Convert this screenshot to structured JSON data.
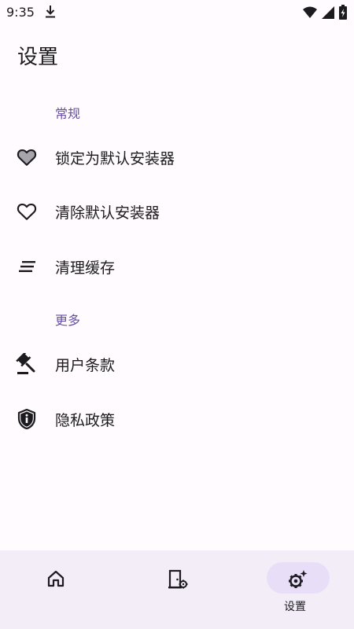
{
  "status_bar": {
    "time": "9:35",
    "icons": [
      "download-icon",
      "wifi-icon",
      "signal-icon",
      "battery-icon"
    ]
  },
  "page": {
    "title": "设置"
  },
  "sections": [
    {
      "header": "常规",
      "items": [
        {
          "label": "锁定为默认安装器",
          "icon": "heart-filled-icon"
        },
        {
          "label": "清除默认安装器",
          "icon": "heart-outline-icon"
        },
        {
          "label": "清理缓存",
          "icon": "clear-all-icon"
        }
      ]
    },
    {
      "header": "更多",
      "items": [
        {
          "label": "用户条款",
          "icon": "gavel-icon"
        },
        {
          "label": "隐私政策",
          "icon": "shield-info-icon"
        }
      ]
    }
  ],
  "bottom_nav": {
    "items": [
      {
        "icon": "home-icon",
        "label": ""
      },
      {
        "icon": "door-settings-icon",
        "label": ""
      },
      {
        "icon": "settings-sparkle-icon",
        "label": "设置",
        "active": true
      }
    ]
  },
  "colors": {
    "background": "#FFFBFE",
    "accent": "#6750A4",
    "nav_background": "#F3EDF7",
    "active_indicator": "#E8DEF8",
    "text": "#1C1B1F"
  }
}
